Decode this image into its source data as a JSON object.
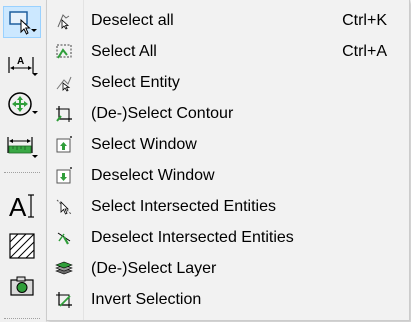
{
  "toolbar": {
    "tools": [
      {
        "icon": "select-dropdown-icon",
        "active": true
      },
      {
        "icon": "dimension-icon"
      },
      {
        "icon": "move-rotate-icon"
      },
      {
        "icon": "measure-ruler-icon"
      },
      {
        "icon": "text-cursor-icon"
      },
      {
        "icon": "hatch-icon"
      },
      {
        "icon": "camera-icon"
      }
    ]
  },
  "menu": {
    "items": [
      {
        "label": "Deselect all",
        "shortcut": "Ctrl+K",
        "icon": "deselect-all-icon"
      },
      {
        "label": "Select All",
        "shortcut": "Ctrl+A",
        "icon": "select-all-icon"
      },
      {
        "label": "Select Entity",
        "shortcut": "",
        "icon": "select-entity-icon"
      },
      {
        "label": "(De-)Select Contour",
        "shortcut": "",
        "icon": "select-contour-icon"
      },
      {
        "label": "Select Window",
        "shortcut": "",
        "icon": "select-window-icon"
      },
      {
        "label": "Deselect Window",
        "shortcut": "",
        "icon": "deselect-window-icon"
      },
      {
        "label": "Select Intersected Entities",
        "shortcut": "",
        "icon": "select-intersected-icon"
      },
      {
        "label": "Deselect Intersected Entities",
        "shortcut": "",
        "icon": "deselect-intersected-icon"
      },
      {
        "label": "(De-)Select Layer",
        "shortcut": "",
        "icon": "select-layer-icon"
      },
      {
        "label": "Invert Selection",
        "shortcut": "",
        "icon": "invert-selection-icon"
      }
    ]
  }
}
